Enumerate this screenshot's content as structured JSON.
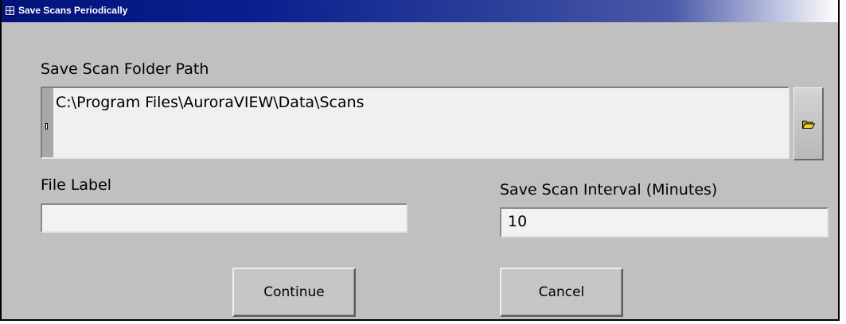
{
  "window": {
    "title": "Save Scans Periodically"
  },
  "folder_path": {
    "label": "Save Scan Folder Path",
    "value": "C:\\Program Files\\AuroraVIEW\\Data\\Scans",
    "browse_icon": "folder-open-icon"
  },
  "file_label": {
    "label": "File Label",
    "value": ""
  },
  "interval": {
    "label": "Save Scan Interval (Minutes)",
    "value": "10"
  },
  "buttons": {
    "continue_label": "Continue",
    "cancel_label": "Cancel"
  },
  "colors": {
    "title_bar": "#0a1f8f",
    "dialog_background": "#c0c0c0",
    "field_background": "#f0f0f0"
  }
}
